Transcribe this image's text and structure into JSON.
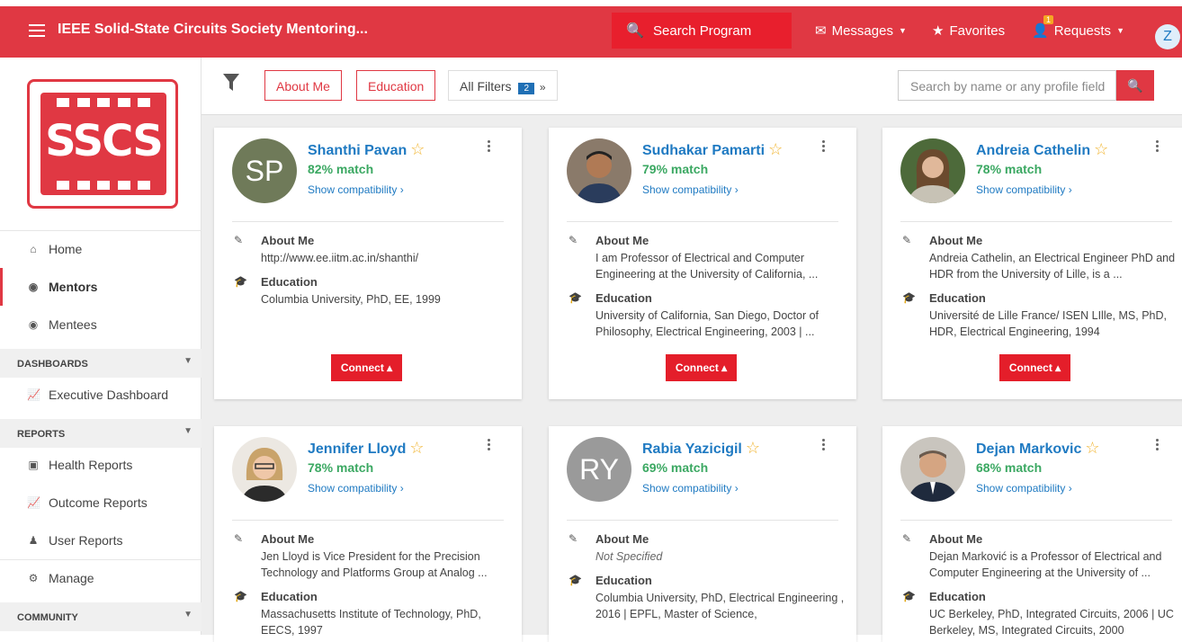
{
  "header": {
    "title": "IEEE Solid-State Circuits Society Mentoring...",
    "search_label": "Search Program",
    "messages_label": "Messages",
    "favorites_label": "Favorites",
    "requests_label": "Requests",
    "requests_badge": "1",
    "avatar_initial": "Z"
  },
  "sidebar": {
    "logo_text": "SSCS",
    "items": {
      "home": "Home",
      "mentors": "Mentors",
      "mentees": "Mentees",
      "dashboards": "DASHBOARDS",
      "exec_dashboard": "Executive Dashboard",
      "reports": "REPORTS",
      "health": "Health Reports",
      "outcome": "Outcome Reports",
      "user": "User Reports",
      "manage": "Manage",
      "community": "COMMUNITY"
    }
  },
  "filters": {
    "about_me": "About Me",
    "education": "Education",
    "all_filters": "All Filters",
    "all_filters_count": "2",
    "more": "»",
    "search_placeholder": "Search by name or any profile field"
  },
  "labels": {
    "about_me": "About Me",
    "education": "Education",
    "show_compat": "Show compatibility ›",
    "connect": "Connect ▴"
  },
  "colors": {
    "brand": "#e03843",
    "link": "#1f7ac2",
    "match": "#3ba862"
  },
  "mentors": [
    {
      "name": "Shanthi Pavan",
      "match": "82% match",
      "initials": "SP",
      "about": "http://www.ee.iitm.ac.in/shanthi/",
      "education": "Columbia University, PhD, EE, 1999"
    },
    {
      "name": "Sudhakar Pamarti",
      "match": "79% match",
      "about": "I am Professor of Electrical and Computer Engineering at the University of California, ...",
      "education": "University of California, San Diego, Doctor of Philosophy, Electrical Engineering, 2003 | ..."
    },
    {
      "name": "Andreia Cathelin",
      "match": "78% match",
      "about": "Andreia Cathelin, an Electrical Engineer PhD and HDR from the University of Lille, is a ...",
      "education": "Université de Lille France/ ISEN LIlle, MS, PhD, HDR, Electrical Engineering, 1994"
    },
    {
      "name": "Jennifer Lloyd",
      "match": "78% match",
      "about": "Jen Lloyd is Vice President for the Precision Technology and Platforms Group at Analog ...",
      "education": "Massachusetts Institute of Technology, PhD, EECS, 1997"
    },
    {
      "name": "Rabia Yazicigil",
      "match": "69% match",
      "initials": "RY",
      "about": "Not Specified",
      "education": "Columbia University, PhD, Electrical Engineering , 2016 | EPFL, Master of Science,"
    },
    {
      "name": "Dejan Markovic",
      "match": "68% match",
      "about": "Dejan Marković is a Professor of Electrical and Computer Engineering at the University of ...",
      "education": "UC Berkeley, PhD, Integrated Circuits, 2006 | UC Berkeley, MS, Integrated Circuits, 2000"
    }
  ]
}
